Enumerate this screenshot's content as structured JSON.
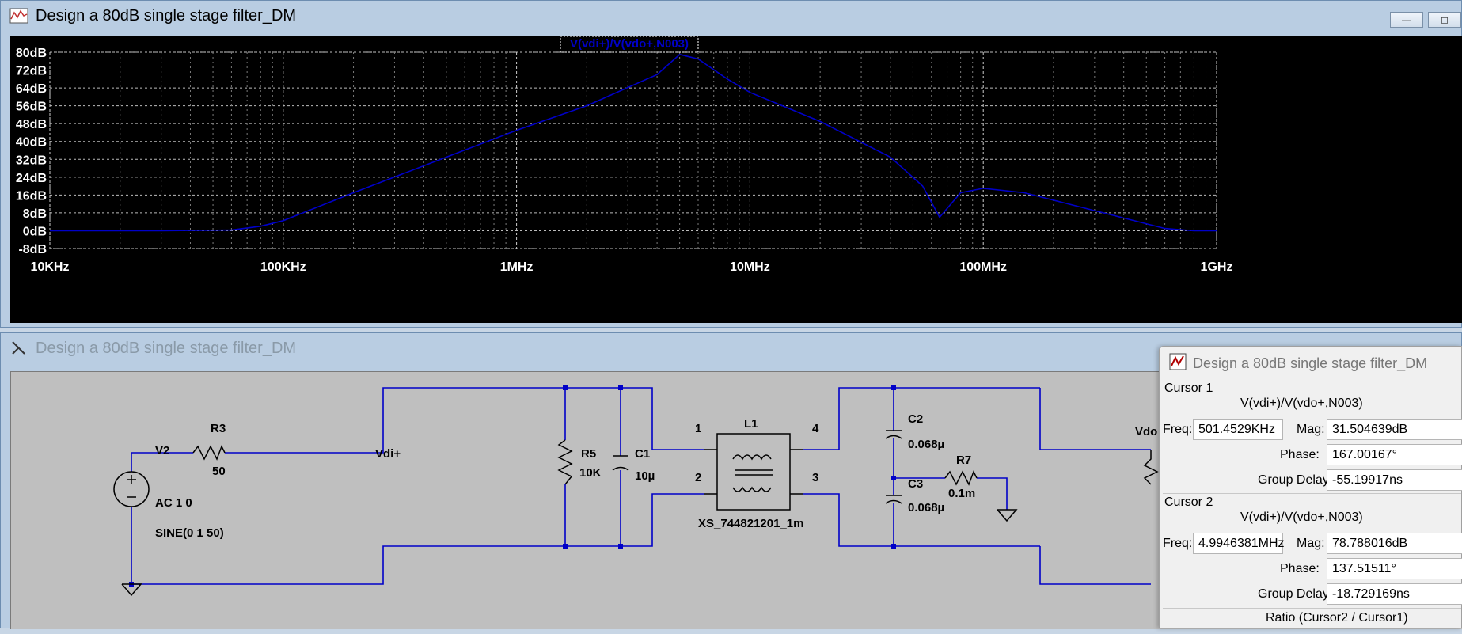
{
  "plot_window": {
    "title": "Design a 80dB single stage filter_DM",
    "trace_label": "V(vdi+)/V(vdo+,N003)",
    "trace_color": "#0000c8",
    "controls": {
      "minimize": "—",
      "maximize": "◻"
    }
  },
  "chart_data": {
    "type": "line",
    "x_scale": "log",
    "y_ticks": [
      "80dB",
      "72dB",
      "64dB",
      "56dB",
      "48dB",
      "40dB",
      "32dB",
      "24dB",
      "16dB",
      "8dB",
      "0dB",
      "-8dB"
    ],
    "x_ticks": [
      "10KHz",
      "100KHz",
      "1MHz",
      "10MHz",
      "100MHz",
      "1GHz"
    ],
    "ylim": [
      -8,
      80
    ],
    "xlim_hz": [
      10000,
      1000000000
    ],
    "grid": true,
    "series": [
      {
        "name": "V(vdi+)/V(vdo+,N003)",
        "x": [
          10000,
          30000,
          60000,
          80000,
          100000,
          200000,
          500000,
          1000000,
          2000000,
          4000000,
          5000000,
          6000000,
          8000000,
          10000000,
          20000000,
          40000000,
          55000000,
          65000000,
          80000000,
          100000000,
          150000000,
          300000000,
          600000000,
          800000000,
          1000000000
        ],
        "y": [
          0,
          0,
          0.3,
          2,
          4.5,
          17,
          33,
          45,
          56,
          70,
          79,
          77,
          68,
          62,
          49,
          33,
          20,
          6,
          17,
          19,
          17,
          9,
          1,
          0,
          0
        ]
      }
    ]
  },
  "schematic_window": {
    "title": "Design a 80dB single stage filter_DM",
    "labels": {
      "v2": "V2",
      "ac": "AC 1 0",
      "sine": "SINE(0 1 50)",
      "r3": "R3",
      "r3_val": "50",
      "vdi": "Vdi+",
      "r5": "R5",
      "r5_val": "10K",
      "c1": "C1",
      "c1_val": "10µ",
      "l1": "L1",
      "xs": "XS_744821201_1m",
      "pin1": "1",
      "pin2": "2",
      "pin3": "3",
      "pin4": "4",
      "c2": "C2",
      "c2_val": "0.068µ",
      "c3": "C3",
      "c3_val": "0.068µ",
      "r7": "R7",
      "r7_val": "0.1m",
      "vdo": "Vdo"
    }
  },
  "cursor_window": {
    "title": "Design a 80dB single stage filter_DM",
    "cursor1": {
      "heading": "Cursor 1",
      "expr": "V(vdi+)/V(vdo+,N003)",
      "freq_label": "Freq:",
      "freq": "501.4529KHz",
      "mag_label": "Mag:",
      "mag": "31.504639dB",
      "phase_label": "Phase:",
      "phase": "167.00167°",
      "gd_label": "Group Delay:",
      "gd": "-55.19917ns"
    },
    "cursor2": {
      "heading": "Cursor 2",
      "expr": "V(vdi+)/V(vdo+,N003)",
      "freq_label": "Freq:",
      "freq": "4.9946381MHz",
      "mag_label": "Mag:",
      "mag": "78.788016dB",
      "phase_label": "Phase:",
      "phase": "137.51511°",
      "gd_label": "Group Delay:",
      "gd": "-18.729169ns"
    },
    "ratio": "Ratio (Cursor2 / Cursor1)"
  }
}
